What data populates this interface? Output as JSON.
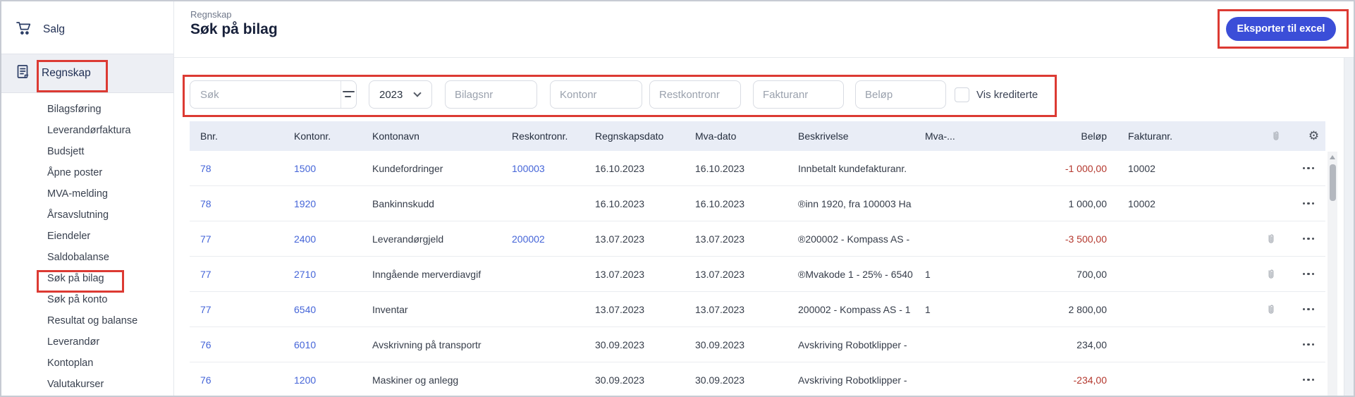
{
  "sidebar": {
    "top_items": [
      {
        "label": "Salg",
        "icon": "cart-icon"
      },
      {
        "label": "Regnskap",
        "icon": "ledger-icon",
        "active": true,
        "annotated": true
      }
    ],
    "sub_items": [
      "Bilagsføring",
      "Leverandørfaktura",
      "Budsjett",
      "Åpne poster",
      "MVA-melding",
      "Årsavslutning",
      "Eiendeler",
      "Saldobalanse",
      "Søk på bilag",
      "Søk på konto",
      "Resultat og balanse",
      "Leverandør",
      "Kontoplan",
      "Valutakurser"
    ],
    "annotated_sub_item": "Søk på bilag"
  },
  "header": {
    "breadcrumb": "Regnskap",
    "title": "Søk på bilag",
    "export_button_label": "Eksporter til excel"
  },
  "filters": {
    "search": {
      "placeholder": "Søk",
      "value": ""
    },
    "year_selected": "2023",
    "fields": [
      {
        "placeholder": "Bilagsnr"
      },
      {
        "placeholder": "Kontonr"
      },
      {
        "placeholder": "Restkontronr"
      },
      {
        "placeholder": "Fakturanr"
      },
      {
        "placeholder": "Beløp"
      }
    ],
    "checkbox_label": "Vis krediterte",
    "checkbox_checked": false
  },
  "table": {
    "columns": [
      "Bnr.",
      "Kontonr.",
      "Kontonavn",
      "Reskontronr.",
      "Regnskapsdato",
      "Mva-dato",
      "Beskrivelse",
      "Mva-...",
      "Beløp",
      "Fakturanr."
    ],
    "rows": [
      {
        "bnr": "78",
        "kontonr": "1500",
        "kontonavn": "Kundefordringer",
        "reskontronr": "100003",
        "regnskapsdato": "16.10.2023",
        "mva_dato": "16.10.2023",
        "beskrivelse": "Innbetalt kundefakturanr.",
        "mva": "",
        "belop": "-1 000,00",
        "belop_negative": true,
        "fakturanr": "10002",
        "attachment": false
      },
      {
        "bnr": "78",
        "kontonr": "1920",
        "kontonavn": "Bankinnskudd",
        "reskontronr": "",
        "regnskapsdato": "16.10.2023",
        "mva_dato": "16.10.2023",
        "beskrivelse": "®inn 1920, fra 100003 Ha",
        "mva": "",
        "belop": "1 000,00",
        "belop_negative": false,
        "fakturanr": "10002",
        "attachment": false
      },
      {
        "bnr": "77",
        "kontonr": "2400",
        "kontonavn": "Leverandørgjeld",
        "reskontronr": "200002",
        "regnskapsdato": "13.07.2023",
        "mva_dato": "13.07.2023",
        "beskrivelse": "®200002 - Kompass AS -",
        "mva": "",
        "belop": "-3 500,00",
        "belop_negative": true,
        "fakturanr": "",
        "attachment": true
      },
      {
        "bnr": "77",
        "kontonr": "2710",
        "kontonavn": "Inngående merverdiavgif",
        "reskontronr": "",
        "regnskapsdato": "13.07.2023",
        "mva_dato": "13.07.2023",
        "beskrivelse": "®Mvakode 1 - 25% - 6540",
        "mva": "1",
        "belop": "700,00",
        "belop_negative": false,
        "fakturanr": "",
        "attachment": true
      },
      {
        "bnr": "77",
        "kontonr": "6540",
        "kontonavn": "Inventar",
        "reskontronr": "",
        "regnskapsdato": "13.07.2023",
        "mva_dato": "13.07.2023",
        "beskrivelse": "200002 - Kompass AS - 1",
        "mva": "1",
        "belop": "2 800,00",
        "belop_negative": false,
        "fakturanr": "",
        "attachment": true
      },
      {
        "bnr": "76",
        "kontonr": "6010",
        "kontonavn": "Avskrivning på transportr",
        "reskontronr": "",
        "regnskapsdato": "30.09.2023",
        "mva_dato": "30.09.2023",
        "beskrivelse": "Avskriving Robotklipper -",
        "mva": "",
        "belop": "234,00",
        "belop_negative": false,
        "fakturanr": "",
        "attachment": false
      },
      {
        "bnr": "76",
        "kontonr": "1200",
        "kontonavn": "Maskiner og anlegg",
        "reskontronr": "",
        "regnskapsdato": "30.09.2023",
        "mva_dato": "30.09.2023",
        "beskrivelse": "Avskriving Robotklipper -",
        "mva": "",
        "belop": "-234,00",
        "belop_negative": true,
        "fakturanr": "",
        "attachment": false
      }
    ]
  },
  "colors": {
    "accent_blue": "#3b4ed8",
    "link_blue": "#4565d8",
    "negative_red": "#b4382e",
    "annotation_red": "#dc3a33",
    "table_header_bg": "#e9edf6",
    "sidebar_active_bg": "#edeff4"
  }
}
